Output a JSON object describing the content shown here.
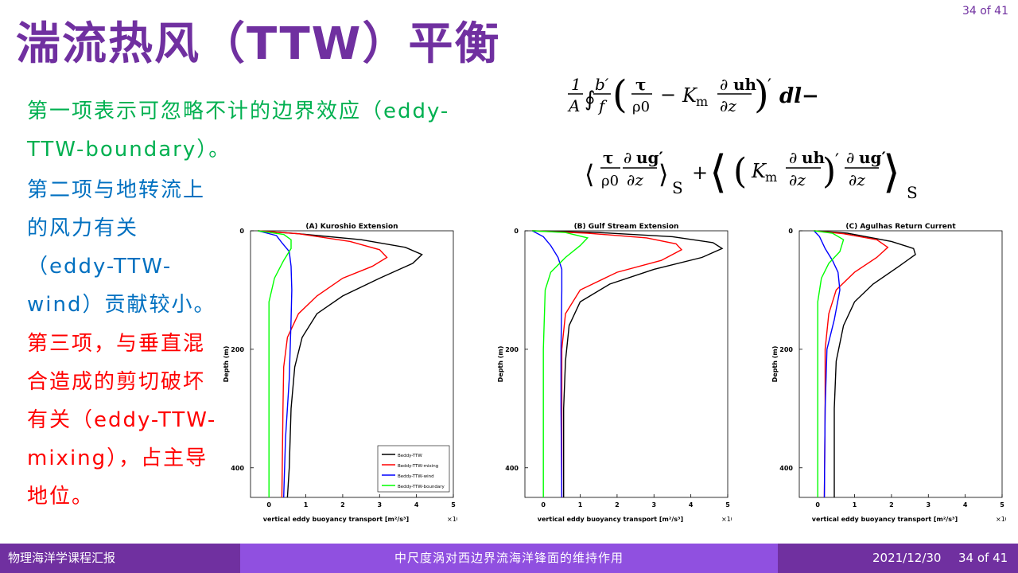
{
  "slide": {
    "title": "湍流热风（TTW）平衡",
    "page_number": "34 of 41",
    "text": {
      "green": "第一项表示可忽略不计的边界效应（eddy-TTW-boundary）。",
      "blue": "第二项与地转流上的风力有关（eddy-TTW-wind）贡献较小。",
      "red": "第三项，与垂直混合造成的剪切破坏有关（eddy-TTW-mixing），占主导地位。"
    }
  },
  "footer": {
    "left": "物理海洋学课程汇报",
    "center": "中尺度涡对西边界流海洋锋面的维持作用",
    "date": "2021/12/30",
    "page": "34 of 41"
  },
  "formula": {
    "pre": "1",
    "A": "A",
    "b": "b′",
    "f": "f",
    "tau": "τ",
    "rho": "ρ0",
    "minus": "−",
    "K": "K",
    "m": "m",
    "d": "∂",
    "uh": "uh",
    "dz": "∂z",
    "prime": "′",
    "dl": "dl−",
    "ug": "ug′",
    "S": "S",
    "plus": "+"
  },
  "colors": {
    "title": "#7030a0",
    "green": "#00b050",
    "blue": "#0070c0",
    "red": "#ff0000",
    "footer": "#7030a0",
    "footer_center": "#9050e0",
    "ttw": "#000000",
    "mixing": "#ff0000",
    "wind": "#0000ff",
    "boundary": "#00ff00"
  },
  "chart_data": [
    {
      "type": "line",
      "title": "(A) Kuroshio Extension",
      "xlabel": "vertical eddy buoyancy transport [m²/s³]",
      "xscale": "×10⁻⁸",
      "ylabel": "Depth (m)",
      "xlim": [
        -0.5,
        5
      ],
      "ylim": [
        0,
        450
      ],
      "xticks": [
        "0",
        "1",
        "2",
        "3",
        "4",
        "5"
      ],
      "yticks": [
        "0",
        "200",
        "400"
      ],
      "legend": [
        "Beddy-TTW",
        "Beddy-TTW-mixing",
        "Beddy-TTW-wind",
        "Beddy-TTW-boundary"
      ],
      "series": [
        {
          "name": "Beddy-TTW",
          "points": [
            [
              -0.3,
              0
            ],
            [
              0.8,
              5
            ],
            [
              2.5,
              15
            ],
            [
              3.7,
              28
            ],
            [
              4.15,
              40
            ],
            [
              3.9,
              55
            ],
            [
              3.0,
              80
            ],
            [
              2.0,
              110
            ],
            [
              1.3,
              140
            ],
            [
              0.9,
              180
            ],
            [
              0.7,
              230
            ],
            [
              0.6,
              300
            ],
            [
              0.55,
              400
            ],
            [
              0.5,
              450
            ]
          ]
        },
        {
          "name": "Beddy-TTW-mixing",
          "points": [
            [
              -0.3,
              0
            ],
            [
              0.8,
              5
            ],
            [
              2.2,
              18
            ],
            [
              3.0,
              32
            ],
            [
              3.2,
              45
            ],
            [
              2.8,
              60
            ],
            [
              2.0,
              80
            ],
            [
              1.3,
              110
            ],
            [
              0.8,
              140
            ],
            [
              0.5,
              180
            ],
            [
              0.4,
              230
            ],
            [
              0.38,
              300
            ],
            [
              0.36,
              400
            ],
            [
              0.35,
              450
            ]
          ]
        },
        {
          "name": "Beddy-TTW-wind",
          "points": [
            [
              -0.3,
              0
            ],
            [
              0.2,
              8
            ],
            [
              0.35,
              20
            ],
            [
              0.55,
              35
            ],
            [
              0.6,
              60
            ],
            [
              0.62,
              100
            ],
            [
              0.6,
              150
            ],
            [
              0.55,
              250
            ],
            [
              0.45,
              350
            ],
            [
              0.4,
              450
            ]
          ]
        },
        {
          "name": "Beddy-TTW-boundary",
          "points": [
            [
              -0.3,
              0
            ],
            [
              0.4,
              6
            ],
            [
              0.6,
              15
            ],
            [
              0.6,
              30
            ],
            [
              0.4,
              50
            ],
            [
              0.15,
              80
            ],
            [
              0.0,
              120
            ],
            [
              0.0,
              200
            ],
            [
              0.0,
              300
            ],
            [
              0.0,
              450
            ]
          ]
        }
      ]
    },
    {
      "type": "line",
      "title": "(B) Gulf Stream Extension",
      "xlabel": "vertical eddy buoyancy transport [m²/s³]",
      "xscale": "×10⁻⁸",
      "ylabel": "Depth (m)",
      "xlim": [
        -0.5,
        5
      ],
      "ylim": [
        0,
        450
      ],
      "xticks": [
        "0",
        "1",
        "2",
        "3",
        "4",
        "5"
      ],
      "yticks": [
        "0",
        "200",
        "400"
      ],
      "series": [
        {
          "name": "Beddy-TTW",
          "points": [
            [
              -0.3,
              0
            ],
            [
              1.5,
              3
            ],
            [
              3.5,
              10
            ],
            [
              4.6,
              20
            ],
            [
              4.85,
              30
            ],
            [
              4.3,
              45
            ],
            [
              3.0,
              65
            ],
            [
              1.8,
              90
            ],
            [
              1.0,
              120
            ],
            [
              0.7,
              160
            ],
            [
              0.6,
              220
            ],
            [
              0.55,
              300
            ],
            [
              0.55,
              450
            ]
          ]
        },
        {
          "name": "Beddy-TTW-mixing",
          "points": [
            [
              -0.3,
              0
            ],
            [
              1.2,
              4
            ],
            [
              2.8,
              12
            ],
            [
              3.6,
              22
            ],
            [
              3.75,
              32
            ],
            [
              3.2,
              50
            ],
            [
              2.0,
              70
            ],
            [
              1.0,
              100
            ],
            [
              0.6,
              140
            ],
            [
              0.5,
              200
            ],
            [
              0.5,
              300
            ],
            [
              0.5,
              450
            ]
          ]
        },
        {
          "name": "Beddy-TTW-wind",
          "points": [
            [
              -0.3,
              0
            ],
            [
              0.0,
              10
            ],
            [
              0.2,
              25
            ],
            [
              0.4,
              45
            ],
            [
              0.5,
              65
            ],
            [
              0.5,
              100
            ],
            [
              0.48,
              200
            ],
            [
              0.48,
              300
            ],
            [
              0.5,
              450
            ]
          ]
        },
        {
          "name": "Beddy-TTW-boundary",
          "points": [
            [
              -0.3,
              0
            ],
            [
              0.6,
              3
            ],
            [
              1.2,
              12
            ],
            [
              1.0,
              25
            ],
            [
              0.6,
              45
            ],
            [
              0.2,
              70
            ],
            [
              0.05,
              100
            ],
            [
              0.0,
              200
            ],
            [
              0.0,
              300
            ],
            [
              0.0,
              450
            ]
          ]
        }
      ]
    },
    {
      "type": "line",
      "title": "(C) Agulhas Return Current",
      "xlabel": "vertical eddy buoyancy transport [m²/s³]",
      "xscale": "×10⁻⁸",
      "ylabel": "Depth (m)",
      "xlim": [
        -0.5,
        5
      ],
      "ylim": [
        0,
        450
      ],
      "xticks": [
        "0",
        "1",
        "2",
        "3",
        "4",
        "5"
      ],
      "yticks": [
        "0",
        "200",
        "400"
      ],
      "series": [
        {
          "name": "Beddy-TTW",
          "points": [
            [
              -0.1,
              0
            ],
            [
              0.8,
              4
            ],
            [
              2.0,
              18
            ],
            [
              2.6,
              30
            ],
            [
              2.65,
              40
            ],
            [
              2.2,
              60
            ],
            [
              1.5,
              90
            ],
            [
              1.0,
              120
            ],
            [
              0.7,
              160
            ],
            [
              0.5,
              220
            ],
            [
              0.45,
              300
            ],
            [
              0.45,
              450
            ]
          ]
        },
        {
          "name": "Beddy-TTW-mixing",
          "points": [
            [
              -0.1,
              0
            ],
            [
              0.7,
              5
            ],
            [
              1.6,
              15
            ],
            [
              1.9,
              28
            ],
            [
              1.6,
              45
            ],
            [
              1.0,
              70
            ],
            [
              0.5,
              100
            ],
            [
              0.3,
              140
            ],
            [
              0.2,
              200
            ],
            [
              0.2,
              300
            ],
            [
              0.18,
              450
            ]
          ]
        },
        {
          "name": "Beddy-TTW-wind",
          "points": [
            [
              -0.1,
              0
            ],
            [
              0.05,
              10
            ],
            [
              0.2,
              30
            ],
            [
              0.4,
              50
            ],
            [
              0.55,
              70
            ],
            [
              0.6,
              100
            ],
            [
              0.45,
              150
            ],
            [
              0.25,
              200
            ],
            [
              0.2,
              300
            ],
            [
              0.18,
              450
            ]
          ]
        },
        {
          "name": "Beddy-TTW-boundary",
          "points": [
            [
              -0.1,
              0
            ],
            [
              0.4,
              4
            ],
            [
              0.7,
              15
            ],
            [
              0.6,
              35
            ],
            [
              0.3,
              55
            ],
            [
              0.1,
              80
            ],
            [
              0.0,
              120
            ],
            [
              0.0,
              200
            ],
            [
              0.0,
              300
            ],
            [
              0.0,
              450
            ]
          ]
        }
      ]
    }
  ]
}
